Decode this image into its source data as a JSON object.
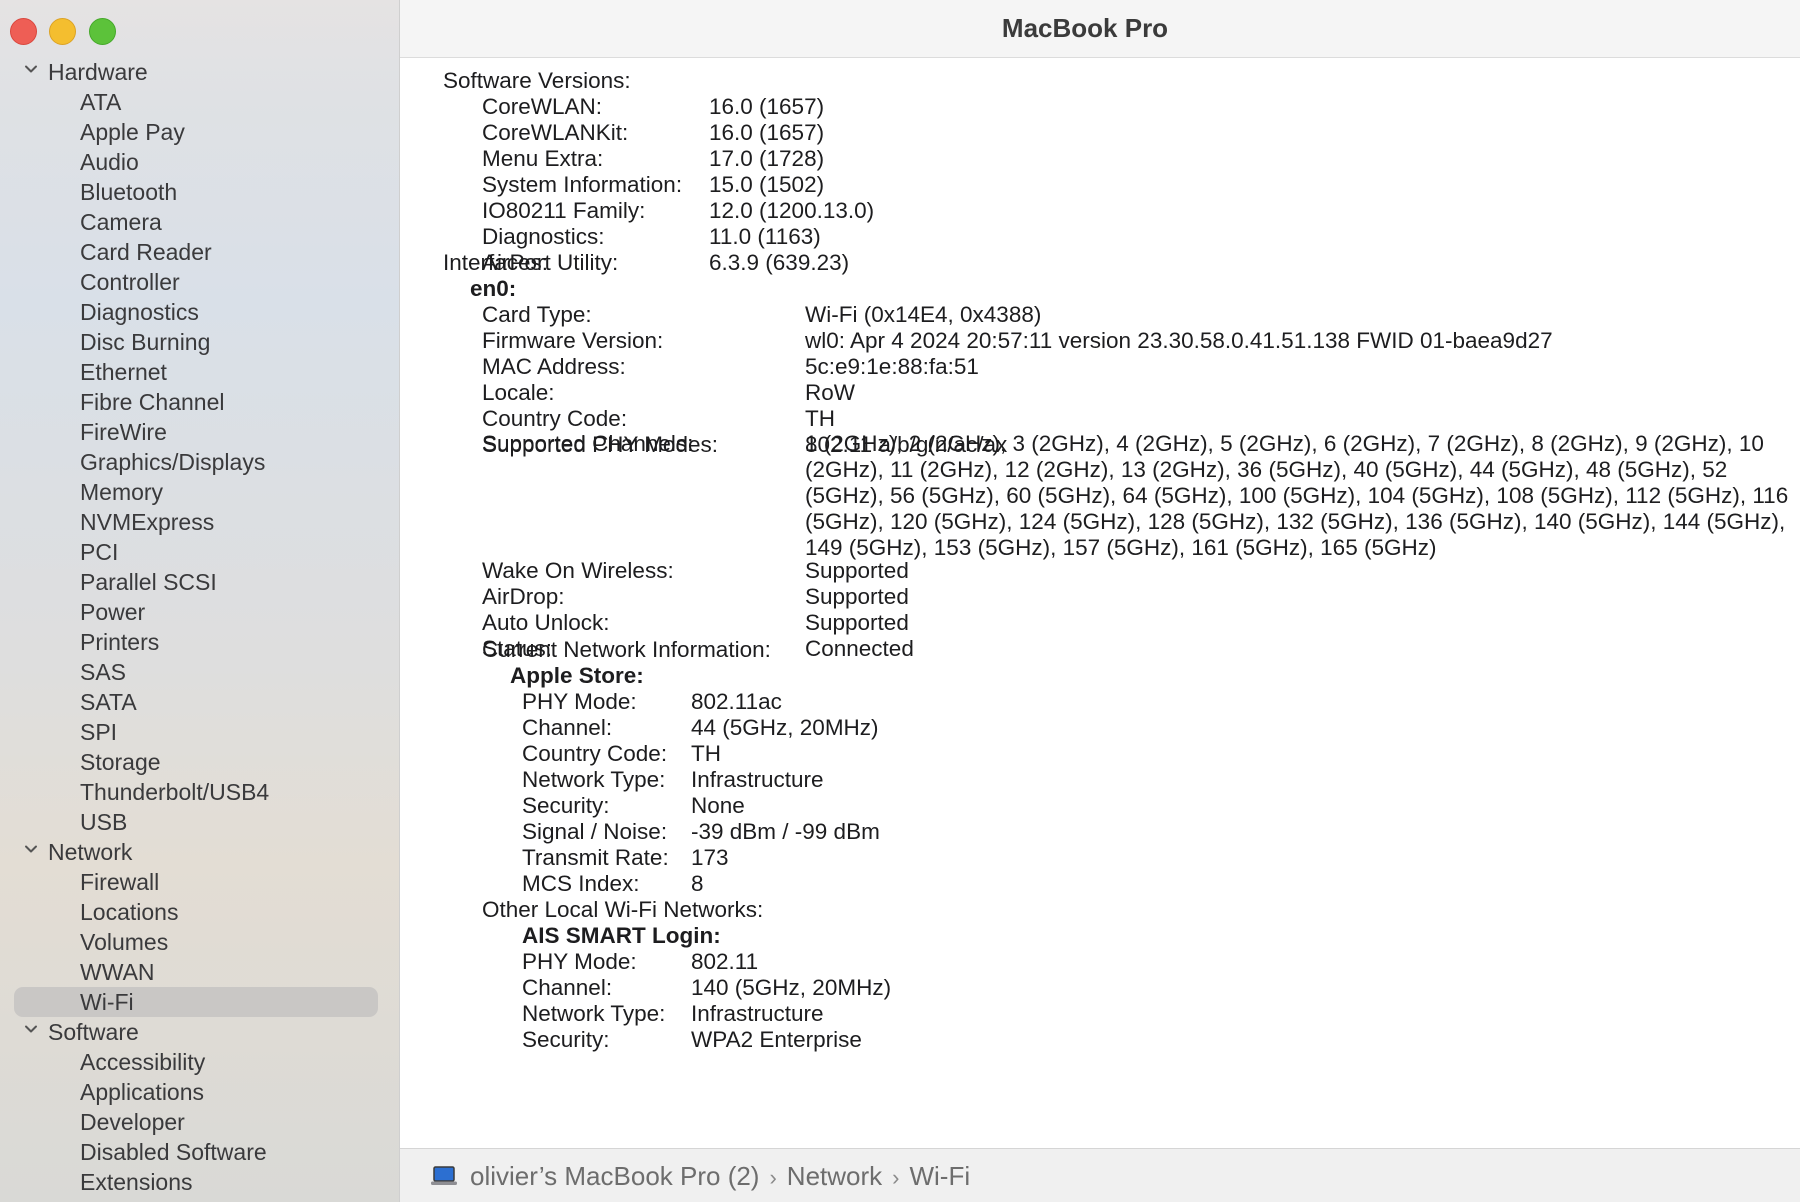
{
  "window": {
    "title": "MacBook Pro"
  },
  "sidebar": {
    "sections": [
      {
        "label": "Hardware",
        "items": [
          "ATA",
          "Apple Pay",
          "Audio",
          "Bluetooth",
          "Camera",
          "Card Reader",
          "Controller",
          "Diagnostics",
          "Disc Burning",
          "Ethernet",
          "Fibre Channel",
          "FireWire",
          "Graphics/Displays",
          "Memory",
          "NVMExpress",
          "PCI",
          "Parallel SCSI",
          "Power",
          "Printers",
          "SAS",
          "SATA",
          "SPI",
          "Storage",
          "Thunderbolt/USB4",
          "USB"
        ]
      },
      {
        "label": "Network",
        "items": [
          "Firewall",
          "Locations",
          "Volumes",
          "WWAN",
          "Wi-Fi"
        ]
      },
      {
        "label": "Software",
        "items": [
          "Accessibility",
          "Applications",
          "Developer",
          "Disabled Software",
          "Extensions"
        ]
      }
    ],
    "selected": "Wi-Fi"
  },
  "software": {
    "header": "Software Versions:",
    "rows": [
      {
        "label": "CoreWLAN:",
        "value": "16.0 (1657)"
      },
      {
        "label": "CoreWLANKit:",
        "value": "16.0 (1657)"
      },
      {
        "label": "Menu Extra:",
        "value": "17.0 (1728)"
      },
      {
        "label": "System Information:",
        "value": "15.0 (1502)"
      },
      {
        "label": "IO80211 Family:",
        "value": "12.0 (1200.13.0)"
      },
      {
        "label": "Diagnostics:",
        "value": "11.0 (1163)"
      },
      {
        "label": "AirPort Utility:",
        "value": "6.3.9 (639.23)"
      }
    ]
  },
  "interfaces": {
    "header": "Interfaces:",
    "name": "en0:",
    "rows": [
      {
        "label": "Card Type:",
        "value": "Wi-Fi  (0x14E4, 0x4388)"
      },
      {
        "label": "Firmware Version:",
        "value": "wl0: Apr  4 2024 20:57:11 version 23.30.58.0.41.51.138 FWID 01-baea9d27"
      },
      {
        "label": "MAC Address:",
        "value": "5c:e9:1e:88:fa:51"
      },
      {
        "label": "Locale:",
        "value": "RoW"
      },
      {
        "label": "Country Code:",
        "value": "TH"
      },
      {
        "label": "Supported PHY Modes:",
        "value": "802.11 a/b/g/n/ac/ax"
      }
    ],
    "channels_label": "Supported Channels:",
    "channels_value": "1 (2GHz), 2 (2GHz), 3 (2GHz), 4 (2GHz), 5 (2GHz), 6 (2GHz), 7 (2GHz), 8 (2GHz), 9 (2GHz), 10 (2GHz), 11 (2GHz), 12 (2GHz), 13 (2GHz), 36 (5GHz), 40 (5GHz), 44 (5GHz), 48 (5GHz), 52 (5GHz), 56 (5GHz), 60 (5GHz), 64 (5GHz), 100 (5GHz), 104 (5GHz), 108 (5GHz), 112 (5GHz), 116 (5GHz), 120 (5GHz), 124 (5GHz), 128 (5GHz), 132 (5GHz), 136 (5GHz), 140 (5GHz), 144 (5GHz), 149 (5GHz), 153 (5GHz), 157 (5GHz), 161 (5GHz), 165 (5GHz)",
    "rows2": [
      {
        "label": "Wake On Wireless:",
        "value": "Supported"
      },
      {
        "label": "AirDrop:",
        "value": "Supported"
      },
      {
        "label": "Auto Unlock:",
        "value": "Supported"
      },
      {
        "label": "Status:",
        "value": "Connected"
      }
    ]
  },
  "current_network": {
    "header": "Current Network Information:",
    "name": "Apple Store:",
    "rows": [
      {
        "label": "PHY Mode:",
        "value": "802.11ac"
      },
      {
        "label": "Channel:",
        "value": "44 (5GHz, 20MHz)"
      },
      {
        "label": "Country Code:",
        "value": "TH"
      },
      {
        "label": "Network Type:",
        "value": "Infrastructure"
      },
      {
        "label": "Security:",
        "value": "None"
      },
      {
        "label": "Signal / Noise:",
        "value": "-39 dBm / -99 dBm"
      },
      {
        "label": "Transmit Rate:",
        "value": "173"
      },
      {
        "label": "MCS Index:",
        "value": "8"
      }
    ]
  },
  "other_networks": {
    "header": "Other Local Wi-Fi Networks:",
    "name": "AIS SMART Login:",
    "rows": [
      {
        "label": "PHY Mode:",
        "value": "802.11"
      },
      {
        "label": "Channel:",
        "value": "140 (5GHz, 20MHz)"
      },
      {
        "label": "Network Type:",
        "value": "Infrastructure"
      },
      {
        "label": "Security:",
        "value": "WPA2 Enterprise"
      }
    ]
  },
  "statusbar": {
    "path": [
      "olivier’s MacBook Pro (2)",
      "Network",
      "Wi-Fi"
    ],
    "separator": "›",
    "icon": "laptop-icon"
  }
}
